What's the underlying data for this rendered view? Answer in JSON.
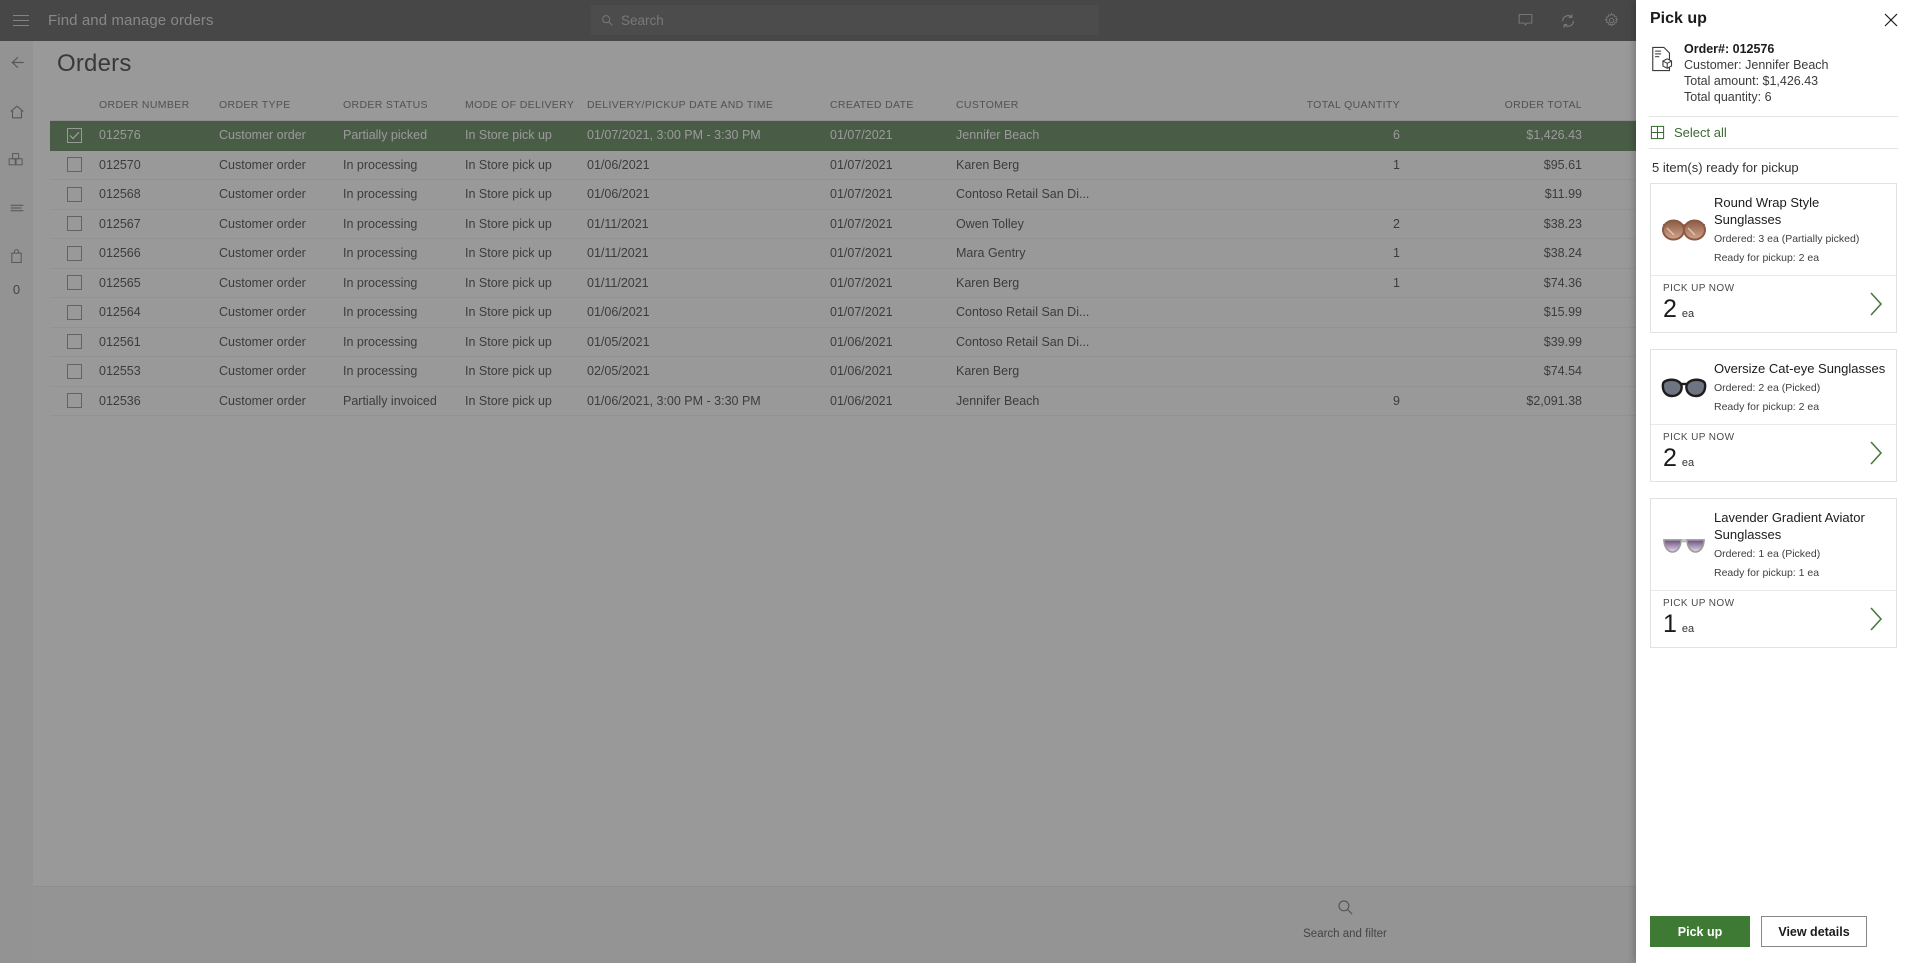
{
  "header": {
    "title": "Find and manage orders",
    "menu_icon": "hamburger-icon",
    "search_placeholder": "Search",
    "icons": [
      "display-icon",
      "refresh-icon",
      "settings-icon"
    ]
  },
  "rail": {
    "items": [
      {
        "name": "back",
        "icon": "arrow-left-icon"
      },
      {
        "name": "home",
        "icon": "home-icon"
      },
      {
        "name": "products",
        "icon": "boxes-icon"
      },
      {
        "name": "lines",
        "icon": "list-icon"
      },
      {
        "name": "bag",
        "icon": "shopping-bag-icon"
      }
    ],
    "badge": "0"
  },
  "page": {
    "title": "Orders"
  },
  "grid": {
    "columns": [
      "ORDER NUMBER",
      "ORDER TYPE",
      "ORDER STATUS",
      "MODE OF DELIVERY",
      "DELIVERY/PICKUP DATE AND TIME",
      "CREATED DATE",
      "CUSTOMER",
      "TOTAL QUANTITY",
      "ORDER TOTAL"
    ],
    "rows": [
      {
        "selected": true,
        "order_number": "012576",
        "order_type": "Customer order",
        "order_status": "Partially picked",
        "mode_of_delivery": "In Store pick up",
        "delivery_datetime": "01/07/2021, 3:00 PM - 3:30 PM",
        "created_date": "01/07/2021",
        "customer": "Jennifer Beach",
        "total_quantity": "6",
        "order_total": "$1,426.43"
      },
      {
        "selected": false,
        "order_number": "012570",
        "order_type": "Customer order",
        "order_status": "In processing",
        "mode_of_delivery": "In Store pick up",
        "delivery_datetime": "01/06/2021",
        "created_date": "01/07/2021",
        "customer": "Karen Berg",
        "total_quantity": "1",
        "order_total": "$95.61"
      },
      {
        "selected": false,
        "order_number": "012568",
        "order_type": "Customer order",
        "order_status": "In processing",
        "mode_of_delivery": "In Store pick up",
        "delivery_datetime": "01/06/2021",
        "created_date": "01/07/2021",
        "customer": "Contoso Retail San Di...",
        "total_quantity": "",
        "order_total": "$11.99"
      },
      {
        "selected": false,
        "order_number": "012567",
        "order_type": "Customer order",
        "order_status": "In processing",
        "mode_of_delivery": "In Store pick up",
        "delivery_datetime": "01/11/2021",
        "created_date": "01/07/2021",
        "customer": "Owen Tolley",
        "total_quantity": "2",
        "order_total": "$38.23"
      },
      {
        "selected": false,
        "order_number": "012566",
        "order_type": "Customer order",
        "order_status": "In processing",
        "mode_of_delivery": "In Store pick up",
        "delivery_datetime": "01/11/2021",
        "created_date": "01/07/2021",
        "customer": "Mara Gentry",
        "total_quantity": "1",
        "order_total": "$38.24"
      },
      {
        "selected": false,
        "order_number": "012565",
        "order_type": "Customer order",
        "order_status": "In processing",
        "mode_of_delivery": "In Store pick up",
        "delivery_datetime": "01/11/2021",
        "created_date": "01/07/2021",
        "customer": "Karen Berg",
        "total_quantity": "1",
        "order_total": "$74.36"
      },
      {
        "selected": false,
        "order_number": "012564",
        "order_type": "Customer order",
        "order_status": "In processing",
        "mode_of_delivery": "In Store pick up",
        "delivery_datetime": "01/06/2021",
        "created_date": "01/07/2021",
        "customer": "Contoso Retail San Di...",
        "total_quantity": "",
        "order_total": "$15.99"
      },
      {
        "selected": false,
        "order_number": "012561",
        "order_type": "Customer order",
        "order_status": "In processing",
        "mode_of_delivery": "In Store pick up",
        "delivery_datetime": "01/05/2021",
        "created_date": "01/06/2021",
        "customer": "Contoso Retail San Di...",
        "total_quantity": "",
        "order_total": "$39.99"
      },
      {
        "selected": false,
        "order_number": "012553",
        "order_type": "Customer order",
        "order_status": "In processing",
        "mode_of_delivery": "In Store pick up",
        "delivery_datetime": "02/05/2021",
        "created_date": "01/06/2021",
        "customer": "Karen Berg",
        "total_quantity": "",
        "order_total": "$74.54"
      },
      {
        "selected": false,
        "order_number": "012536",
        "order_type": "Customer order",
        "order_status": "Partially invoiced",
        "mode_of_delivery": "In Store pick up",
        "delivery_datetime": "01/06/2021, 3:00 PM - 3:30 PM",
        "created_date": "01/06/2021",
        "customer": "Jennifer Beach",
        "total_quantity": "9",
        "order_total": "$2,091.38"
      }
    ]
  },
  "bottombar": {
    "search_filter_label": "Search and filter",
    "search_filter_icon": "search-icon"
  },
  "flyout": {
    "title": "Pick up",
    "close_icon": "close-icon",
    "order_icon": "order-document-icon",
    "order_number_label": "Order#: 012576",
    "customer_label": "Customer: Jennifer Beach",
    "total_amount_label": "Total amount: $1,426.43",
    "total_quantity_label": "Total quantity: 6",
    "select_all_label": "Select all",
    "select_all_icon": "select-all-grid-icon",
    "ready_line": "5 item(s) ready for pickup",
    "items": [
      {
        "name": "Round Wrap Style Sunglasses",
        "ordered": "Ordered: 3 ea (Partially picked)",
        "ready": "Ready for pickup: 2 ea",
        "pick_up_now_label": "PICK UP NOW",
        "qty": "2",
        "unit": "ea",
        "thumb": "round-wrap-sunglasses-thumb",
        "chevron_icon": "chevron-right-icon"
      },
      {
        "name": "Oversize Cat-eye Sunglasses",
        "ordered": "Ordered: 2 ea (Picked)",
        "ready": "Ready for pickup: 2 ea",
        "pick_up_now_label": "PICK UP NOW",
        "qty": "2",
        "unit": "ea",
        "thumb": "cat-eye-sunglasses-thumb",
        "chevron_icon": "chevron-right-icon"
      },
      {
        "name": "Lavender Gradient Aviator Sunglasses",
        "ordered": "Ordered: 1 ea (Picked)",
        "ready": "Ready for pickup: 1 ea",
        "pick_up_now_label": "PICK UP NOW",
        "qty": "1",
        "unit": "ea",
        "thumb": "aviator-sunglasses-thumb",
        "chevron_icon": "chevron-right-icon"
      }
    ],
    "pick_up_button": "Pick up",
    "view_details_button": "View details"
  },
  "colors": {
    "topbar": "#4a4a4a",
    "selected_row": "#4f7a47",
    "primary_button": "#3f7a34",
    "accent_link": "#3a6b33"
  }
}
